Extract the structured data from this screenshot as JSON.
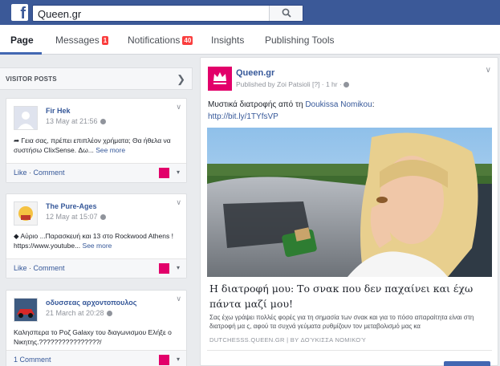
{
  "header": {
    "logo": "f",
    "search_value": "Queen.gr",
    "search_icon": "search-icon"
  },
  "tabs": [
    {
      "label": "Page"
    },
    {
      "label": "Messages",
      "badge": "1"
    },
    {
      "label": "Notifications",
      "badge": "40"
    },
    {
      "label": "Insights"
    },
    {
      "label": "Publishing Tools"
    }
  ],
  "visitor_posts": {
    "title": "VISITOR POSTS",
    "items": [
      {
        "name": "Fir Hek",
        "time": "13 May at 21:56",
        "text": "Γεια σας, πρέπει επιπλέον χρήματα; Θα ήθελα να συστήσω ClixSense. Δω...",
        "more": "See more",
        "like": "Like",
        "comment": "Comment"
      },
      {
        "name": "The Pure-Ages",
        "time": "12 May at 15:07",
        "text": "Αύριο ...Παρασκευή και 13 στο Rockwood Athens ! https://www.youtube...",
        "more": "See more",
        "like": "Like",
        "comment": "Comment"
      },
      {
        "name": "οδυσσεας αρχοντοπουλος",
        "time": "21 March at 20:28",
        "text": "Καλησπερα το Poζ Galaxy του διαγωνισμου Ελήξε ο Νικητης.????????????????/",
        "comment_count": "1 Comment"
      }
    ]
  },
  "post": {
    "page_name": "Queen.gr",
    "meta": "Published by Zoi Patsioli [?] · 1 hr ·",
    "text_prefix": "Μυστικά διατροφής από τη ",
    "mention": "Doukissa Nomikou",
    "text_suffix": ":",
    "url": "http://bit.ly/1TYfsVP",
    "link_title": "Η διατροφή μου: Το σνακ που δεν παχαίνει και έχω πάντα μαζί μου!",
    "link_desc": "Σας έχω γράψει πολλές φορές για τη σημασία των σνακ και για το πόσο απαραίτητα είναι στη διατροφή μα ς, αφού τα συχνά γεύματα ρυθμίζουν τον μεταβολισμό μας κα",
    "link_domain": "DUTCHESSS.QUEEN.GR | BY ΔΟΎΚΙΣΣΑ ΝΟΜΙΚΟΎ"
  },
  "colors": {
    "brand": "#3b5998",
    "accent": "#e2006a",
    "link": "#365899"
  }
}
